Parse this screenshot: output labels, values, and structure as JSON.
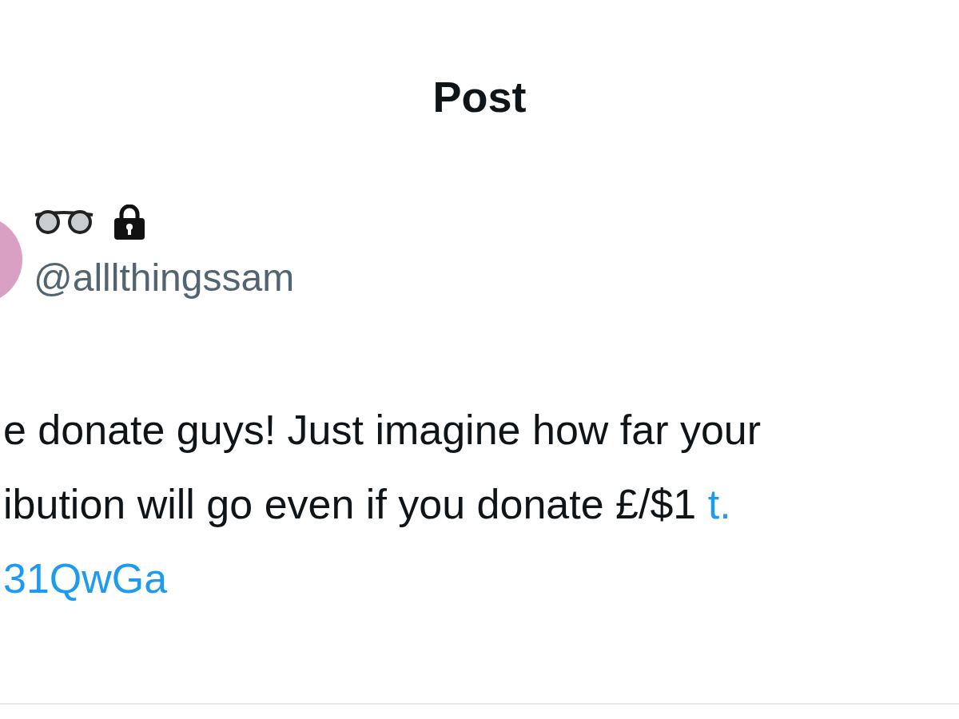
{
  "header": {
    "title": "Post"
  },
  "post": {
    "handle": "@alllthingssam",
    "lines": [
      [
        {
          "kind": "text",
          "text": "e donate guys! Just imagine how far your"
        }
      ],
      [
        {
          "kind": "text",
          "text": "ibution will go even if you donate £/$1"
        },
        {
          "kind": "link",
          "text": "t."
        }
      ],
      [
        {
          "kind": "link",
          "text": "31QwGa"
        }
      ]
    ]
  }
}
